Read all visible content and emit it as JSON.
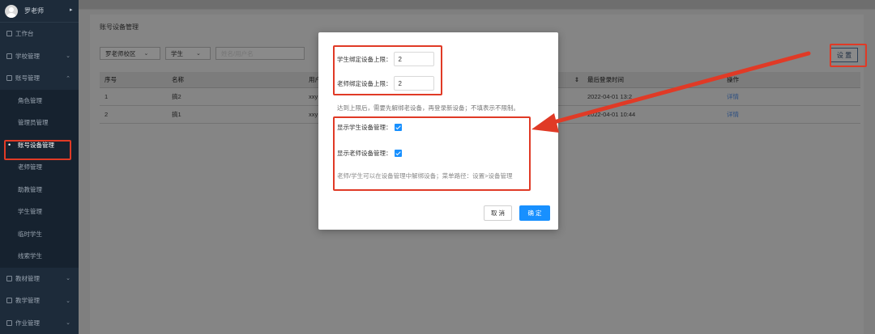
{
  "user": {
    "name": "罗老师",
    "caret": "▸"
  },
  "sidebar": {
    "items": [
      {
        "label": "工作台",
        "type": "top"
      },
      {
        "label": "学校管理",
        "type": "top",
        "arrow": "⌄"
      },
      {
        "label": "账号管理",
        "type": "top",
        "arrow": "⌃"
      },
      {
        "label": "角色管理",
        "type": "sub"
      },
      {
        "label": "管理员管理",
        "type": "sub"
      },
      {
        "label": "账号设备管理",
        "type": "sub",
        "active": true,
        "marker": "•"
      },
      {
        "label": "老师管理",
        "type": "sub"
      },
      {
        "label": "助教管理",
        "type": "sub"
      },
      {
        "label": "学生管理",
        "type": "sub"
      },
      {
        "label": "临时学生",
        "type": "sub"
      },
      {
        "label": "线索学生",
        "type": "sub"
      },
      {
        "label": "教材管理",
        "type": "top",
        "arrow": "⌄"
      },
      {
        "label": "教学管理",
        "type": "top",
        "arrow": "⌄"
      },
      {
        "label": "作业管理",
        "type": "top",
        "arrow": "⌄"
      }
    ]
  },
  "page": {
    "title": "账号设备管理",
    "filters": {
      "campus": "罗老师校区",
      "role": "学生",
      "search_placeholder": "姓名/用户名"
    },
    "settings_button": "设 置",
    "table": {
      "headers": [
        "序号",
        "名称",
        "用户",
        "",
        "最后登录时间",
        "操作"
      ],
      "sort_indicator": "⇕",
      "rows": [
        {
          "index": "1",
          "name": "搞2",
          "user": "xxy",
          "last_login": "2022-04-01 13:2",
          "action": "详情"
        },
        {
          "index": "2",
          "name": "搞1",
          "user": "xxy",
          "last_login": "2022-04-01 10:44",
          "action": "详情"
        }
      ]
    }
  },
  "modal": {
    "student_limit_label": "学生绑定设备上限：",
    "student_limit_value": "2",
    "teacher_limit_label": "老师绑定设备上限：",
    "teacher_limit_value": "2",
    "limit_note": "达到上限后，需要先解绑老设备，再登录新设备；不填表示不限制。",
    "show_student_label": "显示学生设备管理：",
    "show_student_checked": true,
    "show_teacher_label": "显示老师设备管理：",
    "show_teacher_checked": true,
    "path_note": "老师/学生可以在设备管理中解绑设备；菜单路径：设置>设备管理",
    "cancel_label": "取 消",
    "ok_label": "确 定"
  },
  "colors": {
    "sidebar_bg": "#1d2b3a",
    "primary": "#1890ff",
    "annotation_red": "#e03a26"
  }
}
